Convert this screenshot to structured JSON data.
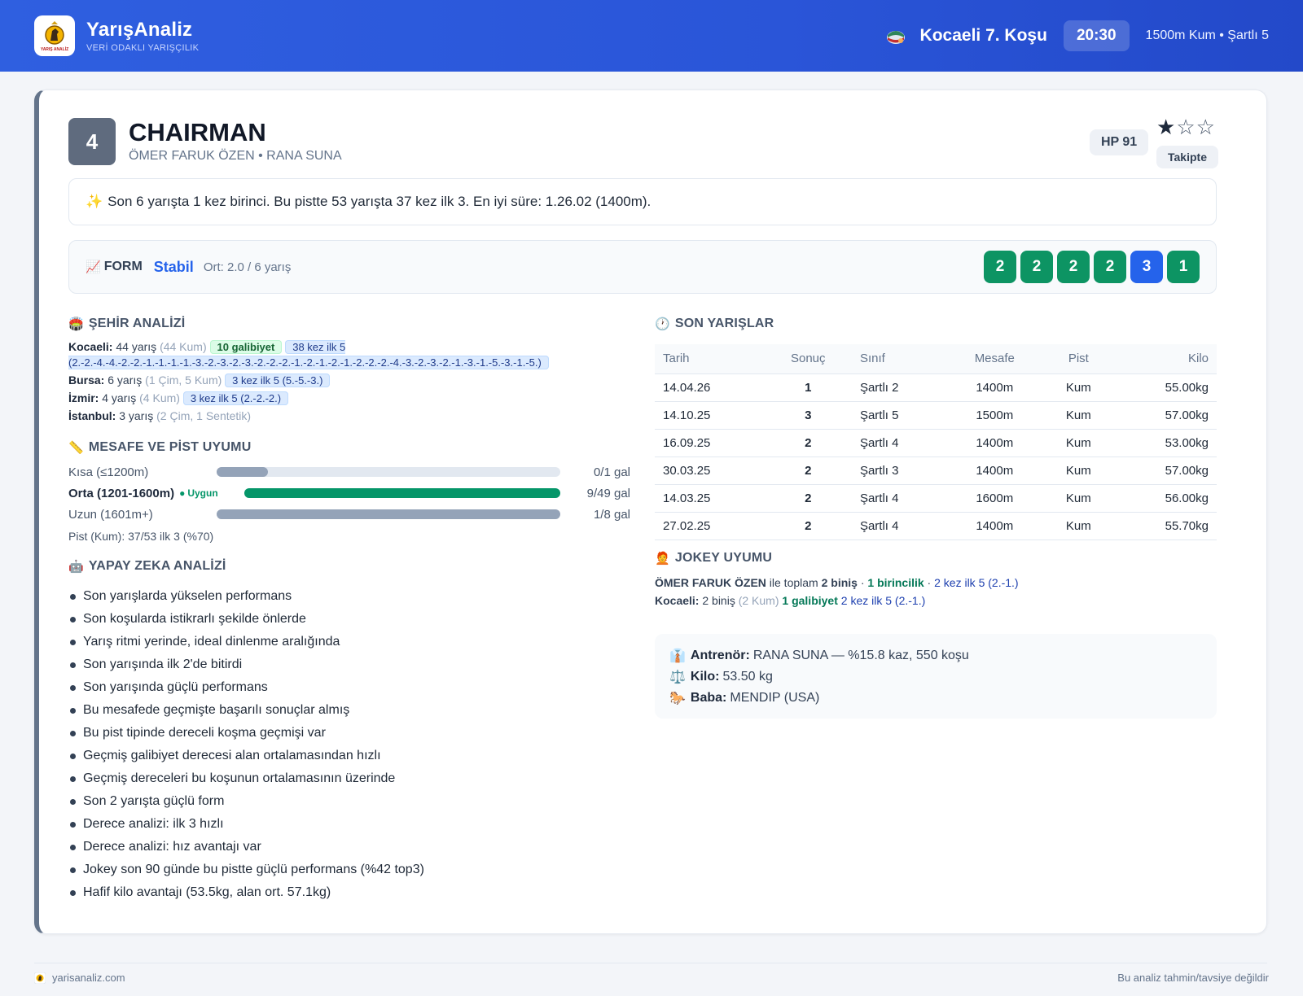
{
  "header": {
    "brand_name": "YarışAnaliz",
    "brand_tag": "VERİ ODAKLI YARIŞÇILIK",
    "logo_text": "YARIŞ ANALİZ",
    "race_title": "Kocaeli 7. Koşu",
    "race_time": "20:30",
    "race_info": "1500m Kum • Şartlı 5"
  },
  "horse": {
    "number": "4",
    "name": "CHAIRMAN",
    "people": "ÖMER FARUK ÖZEN • RANA SUNA",
    "hp": "HP 91",
    "stars_filled": "★",
    "stars_empty": "☆☆",
    "rating": 1,
    "follow_label": "Takipte"
  },
  "summary": {
    "icon": "✨",
    "text": "Son 6 yarışta 1 kez birinci. Bu pistte 53 yarışta 37 kez ilk 3. En iyi süre: 1.26.02 (1400m)."
  },
  "form": {
    "icon": "📈",
    "label": "FORM",
    "state": "Stabil",
    "avg": "Ort: 2.0 / 6 yarış",
    "results": [
      {
        "value": "2",
        "color": "#0d9463"
      },
      {
        "value": "2",
        "color": "#0d9463"
      },
      {
        "value": "2",
        "color": "#0d9463"
      },
      {
        "value": "2",
        "color": "#0d9463"
      },
      {
        "value": "3",
        "color": "#2563eb"
      },
      {
        "value": "1",
        "color": "#0d9463"
      }
    ]
  },
  "city_analysis": {
    "icon": "🏟️",
    "title": "ŞEHİR ANALİZİ",
    "rows": [
      {
        "city": "Kocaeli:",
        "races": "44 yarış",
        "detail": "(44 Kum)",
        "wins": "10 galibiyet",
        "top5": "38 kez ilk 5 (2.-2.-4.-4.-2.-2.-1.-1.-1.-1.-3.-2.-3.-2.-3.-2.-2.-2.-1.-2.-1.-2.-1.-2.-2.-2.-4.-3.-2.-3.-2.-1.-3.-1.-5.-3.-1.-5.)"
      },
      {
        "city": "Bursa:",
        "races": "6 yarış",
        "detail": "(1 Çim, 5 Kum)",
        "wins": "",
        "top5": "3 kez ilk 5 (5.-5.-3.)"
      },
      {
        "city": "İzmir:",
        "races": "4 yarış",
        "detail": "(4 Kum)",
        "wins": "",
        "top5": "3 kez ilk 5 (2.-2.-2.)"
      },
      {
        "city": "İstanbul:",
        "races": "3 yarış",
        "detail": "(2 Çim, 1 Sentetik)",
        "wins": "",
        "top5": ""
      }
    ]
  },
  "distance": {
    "icon": "📏",
    "title": "MESAFE VE PİST UYUMU",
    "rows": [
      {
        "label": "Kısa (≤1200m)",
        "value": "0/1 gal",
        "fill_fraction": 0.15,
        "color": "#94a3b8",
        "badge": ""
      },
      {
        "label": "Orta (1201-1600m)",
        "value": "9/49 gal",
        "fill_fraction": 1.0,
        "color": "#059669",
        "badge": "Uygun"
      },
      {
        "label": "Uzun (1601m+)",
        "value": "1/8 gal",
        "fill_fraction": 1.0,
        "color": "#94a3b8",
        "badge": ""
      }
    ],
    "pist": "Pist (Kum): 37/53 ilk 3 (%70)"
  },
  "ai": {
    "icon": "🤖",
    "title": "YAPAY ZEKA ANALİZİ",
    "items": [
      "Son yarışlarda yükselen performans",
      "Son koşularda istikrarlı şekilde önlerde",
      "Yarış ritmi yerinde, ideal dinlenme aralığında",
      "Son yarışında ilk 2'de bitirdi",
      "Son yarışında güçlü performans",
      "Bu mesafede geçmişte başarılı sonuçlar almış",
      "Bu pist tipinde dereceli koşma geçmişi var",
      "Geçmiş galibiyet derecesi alan ortalamasından hızlı",
      "Geçmiş dereceleri bu koşunun ortalamasının üzerinde",
      "Son 2 yarışta güçlü form",
      "Derece analizi: ilk 3 hızlı",
      "Derece analizi: hız avantajı var",
      "Jokey son 90 günde bu pistte güçlü performans (%42 top3)",
      "Hafif kilo avantajı (53.5kg, alan ort. 57.1kg)"
    ]
  },
  "last_races": {
    "icon": "🕐",
    "title": "SON YARIŞLAR",
    "headers": [
      "Tarih",
      "Sonuç",
      "Sınıf",
      "Mesafe",
      "Pist",
      "Kilo"
    ],
    "rows": [
      {
        "date": "14.04.26",
        "result": "1",
        "class": "Şartlı 2",
        "distance": "1400m",
        "track": "Kum",
        "weight": "55.00kg"
      },
      {
        "date": "14.10.25",
        "result": "3",
        "class": "Şartlı 5",
        "distance": "1500m",
        "track": "Kum",
        "weight": "57.00kg"
      },
      {
        "date": "16.09.25",
        "result": "2",
        "class": "Şartlı 4",
        "distance": "1400m",
        "track": "Kum",
        "weight": "53.00kg"
      },
      {
        "date": "30.03.25",
        "result": "2",
        "class": "Şartlı 3",
        "distance": "1400m",
        "track": "Kum",
        "weight": "57.00kg"
      },
      {
        "date": "14.03.25",
        "result": "2",
        "class": "Şartlı 4",
        "distance": "1600m",
        "track": "Kum",
        "weight": "56.00kg"
      },
      {
        "date": "27.02.25",
        "result": "2",
        "class": "Şartlı 4",
        "distance": "1400m",
        "track": "Kum",
        "weight": "55.70kg"
      }
    ]
  },
  "jockey": {
    "icon": "🧑‍🦰",
    "title": "JOKEY UYUMU",
    "name": "ÖMER FARUK ÖZEN",
    "total_text": "ile toplam",
    "rides": "2 biniş",
    "sep": "·",
    "wins": "1 birincilik",
    "top5": "2 kez ilk 5 (2.-1.)",
    "city": "Kocaeli:",
    "city_rides": "2 biniş",
    "city_detail": "(2 Kum)",
    "city_wins": "1 galibiyet",
    "city_top5": "2 kez ilk 5 (2.-1.)"
  },
  "info": {
    "trainer_icon": "👔",
    "trainer_label": "Antrenör:",
    "trainer_value": "RANA SUNA — %15.8 kaz, 550 koşu",
    "weight_icon": "⚖️",
    "weight_label": "Kilo:",
    "weight_value": "53.50 kg",
    "sire_icon": "🐎",
    "sire_label": "Baba:",
    "sire_value": "MENDIP (USA)"
  },
  "footer": {
    "site": "yarisanaliz.com",
    "disclaimer": "Bu analiz tahmin/tavsiye değildir"
  }
}
